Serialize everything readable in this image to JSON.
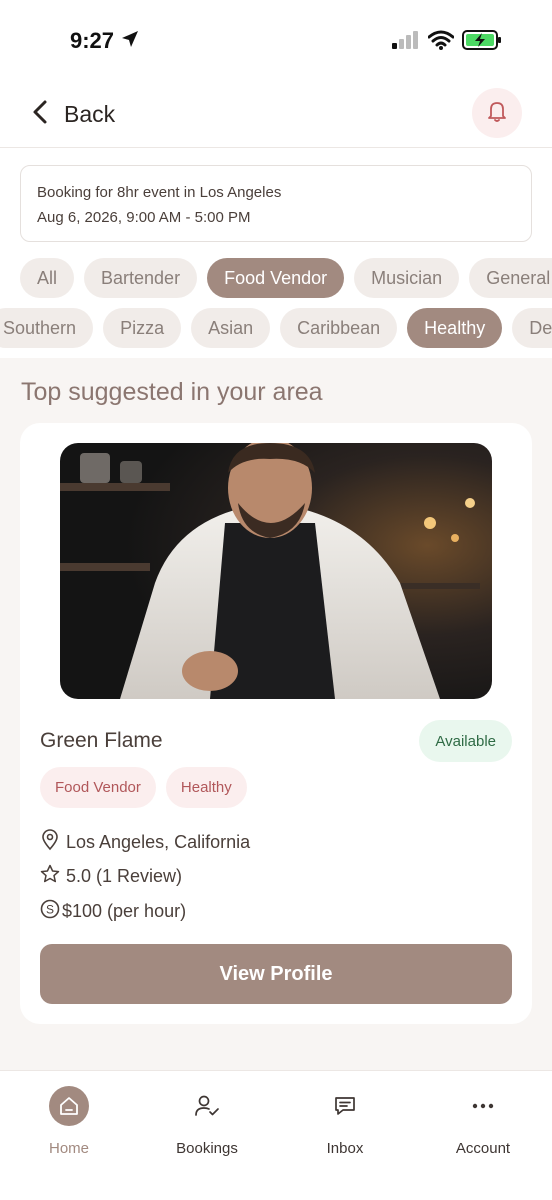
{
  "status_bar": {
    "time": "9:27"
  },
  "header": {
    "back_label": "Back"
  },
  "booking": {
    "line1": "Booking for 8hr event in Los Angeles",
    "line2": "Aug 6, 2026, 9:00 AM - 5:00 PM"
  },
  "categories": [
    "All",
    "Bartender",
    "Food Vendor",
    "Musician",
    "General V"
  ],
  "cuisines": [
    "Southern",
    "Pizza",
    "Asian",
    "Caribbean",
    "Healthy",
    "Desser"
  ],
  "section": {
    "title": "Top suggested in your area"
  },
  "vendor": {
    "name": "Green Flame",
    "availability": "Available",
    "tags": [
      "Food Vendor",
      "Healthy"
    ],
    "location": "Los Angeles, California",
    "rating": "5.0 (1 Review)",
    "price": "$100 (per hour)",
    "cta": "View Profile"
  },
  "tabs": {
    "home": "Home",
    "bookings": "Bookings",
    "inbox": "Inbox",
    "account": "Account"
  },
  "colors": {
    "accent": "#a28a80",
    "chip_bg": "#f1ece9",
    "tag_bg": "#fbeeee",
    "tag_text": "#b1575a",
    "available_bg": "#e9f7ee",
    "available_text": "#2f6b45"
  }
}
